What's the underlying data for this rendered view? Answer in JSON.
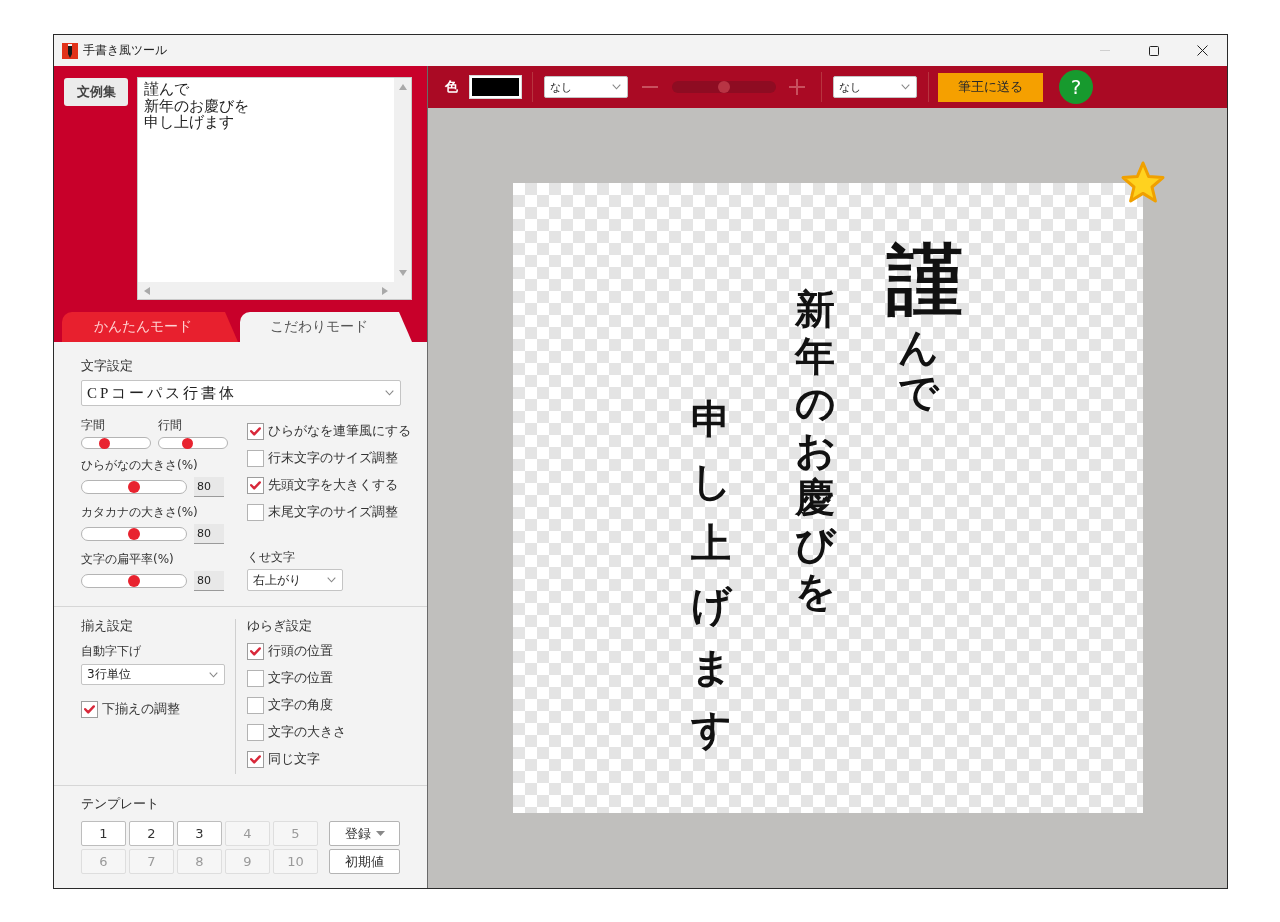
{
  "window": {
    "title": "手書き風ツール",
    "minimize_disabled": true
  },
  "text_panel": {
    "examples_button": "文例集",
    "lines": [
      "謹んで",
      "新年のお慶びを",
      "申し上げます"
    ]
  },
  "mode_tabs": [
    {
      "label": "かんたんモード",
      "selected": false
    },
    {
      "label": "こだわりモード",
      "selected": true
    }
  ],
  "character_settings": {
    "title": "文字設定",
    "font": "CPコーパス行書体",
    "spacing_sliders": [
      {
        "label": "字間",
        "level": 0.3
      },
      {
        "label": "行間",
        "level": 0.4
      }
    ],
    "size_sliders": [
      {
        "label": "ひらがなの大きさ(%)",
        "level": 0.5,
        "value": "80"
      },
      {
        "label": "カタカナの大きさ(%)",
        "level": 0.5,
        "value": "80"
      },
      {
        "label": "文字の扁平率(%)",
        "level": 0.5,
        "value": "80"
      }
    ],
    "options": [
      {
        "label": "ひらがなを連筆風にする",
        "checked": true
      },
      {
        "label": "行末文字のサイズ調整",
        "checked": false
      },
      {
        "label": "先頭文字を大きくする",
        "checked": true
      },
      {
        "label": "末尾文字のサイズ調整",
        "checked": false
      }
    ],
    "quirk_label": "くせ文字",
    "quirk_value": "右上がり"
  },
  "alignment_settings": {
    "title": "揃え設定",
    "indent_label": "自動字下げ",
    "indent_value": "3行単位",
    "options": [
      {
        "label": "下揃えの調整",
        "checked": true
      }
    ]
  },
  "variation_settings": {
    "title": "ゆらぎ設定",
    "options": [
      {
        "label": "行頭の位置",
        "checked": true
      },
      {
        "label": "文字の位置",
        "checked": false
      },
      {
        "label": "文字の角度",
        "checked": false
      },
      {
        "label": "文字の大きさ",
        "checked": false
      },
      {
        "label": "同じ文字",
        "checked": true
      }
    ]
  },
  "templates": {
    "title": "テンプレート",
    "slots": [
      {
        "label": "1",
        "disabled": false
      },
      {
        "label": "2",
        "disabled": false
      },
      {
        "label": "3",
        "disabled": false
      },
      {
        "label": "4",
        "disabled": true
      },
      {
        "label": "5",
        "disabled": true
      },
      {
        "label": "6",
        "disabled": true
      },
      {
        "label": "7",
        "disabled": true
      },
      {
        "label": "8",
        "disabled": true
      },
      {
        "label": "9",
        "disabled": true
      },
      {
        "label": "10",
        "disabled": true
      }
    ],
    "register_button": "登録",
    "reset_button": "初期値"
  },
  "toolbar": {
    "color_label": "色",
    "color": "#000000",
    "dropdown_1": "なし",
    "brush_slider": {
      "level": 0.5,
      "disabled": true
    },
    "dropdown_2": "なし",
    "send_button": "筆王に送る",
    "help_button": "?"
  },
  "preview": {
    "columns": [
      "謹んで",
      "新年のお慶びを",
      "申し上げます"
    ]
  }
}
